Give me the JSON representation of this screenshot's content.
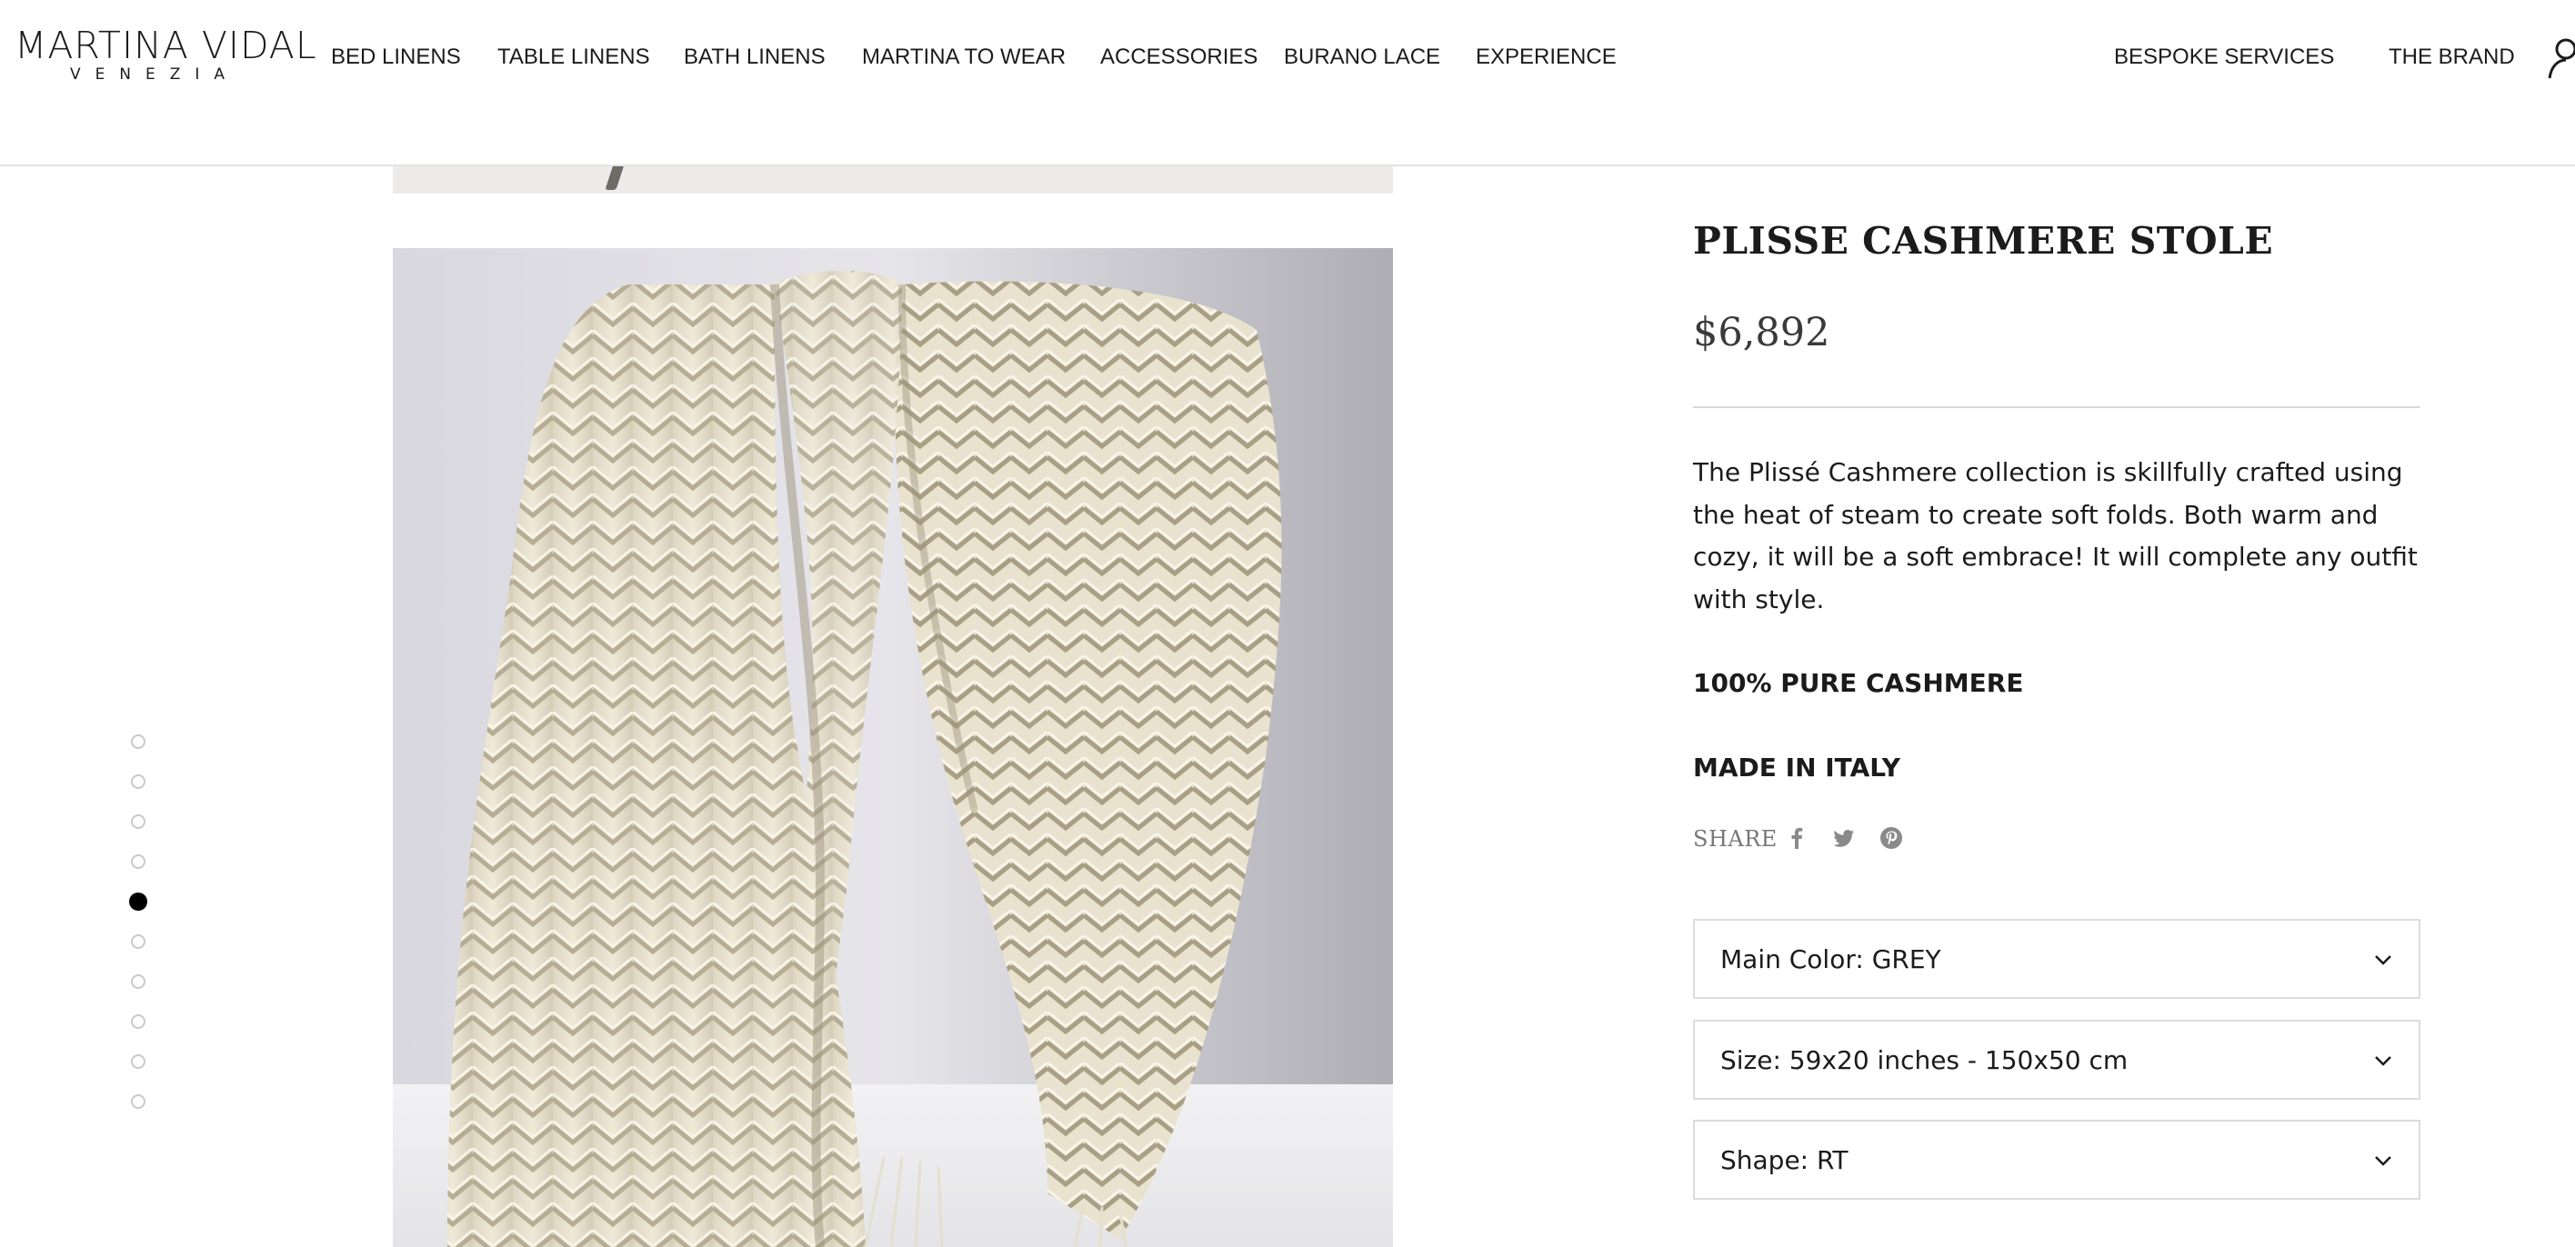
{
  "brand": {
    "name": "MARTINA VIDAL",
    "subtitle": "VENEZIA"
  },
  "nav": {
    "items": [
      {
        "label": "BED LINENS"
      },
      {
        "label": "TABLE LINENS"
      },
      {
        "label": "BATH LINENS"
      },
      {
        "label": "MARTINA TO WEAR"
      },
      {
        "label": "ACCESSORIES"
      },
      {
        "label": "BURANO LACE"
      },
      {
        "label": "EXPERIENCE"
      }
    ],
    "right_items": [
      {
        "label": "BESPOKE SERVICES"
      },
      {
        "label": "THE BRAND"
      }
    ],
    "account_icon": "user-icon"
  },
  "gallery": {
    "image_count": 10,
    "active_index": 4,
    "image_subject": "cream pleated cashmere stole"
  },
  "product": {
    "title": "PLISSE CASHMERE STOLE",
    "price": "$6,892",
    "description": "The Plissé Cashmere collection is skillfully crafted using the heat of steam to create soft folds. Both warm and cozy, it will be a soft embrace! It will complete any outfit with style.",
    "material": "100% PURE CASHMERE",
    "origin": "MADE IN ITALY",
    "share": {
      "label": "SHARE",
      "icons": [
        "facebook-icon",
        "twitter-icon",
        "pinterest-icon"
      ]
    },
    "options": [
      {
        "label": "Main Color: GREY"
      },
      {
        "label": "Size: 59x20 inches - 150x50 cm"
      },
      {
        "label": "Shape: RT"
      }
    ]
  },
  "colors": {
    "text": "#1c1b1b",
    "muted": "#777777",
    "border": "#dcdcdc",
    "product_cream": "#ebe5d3"
  }
}
